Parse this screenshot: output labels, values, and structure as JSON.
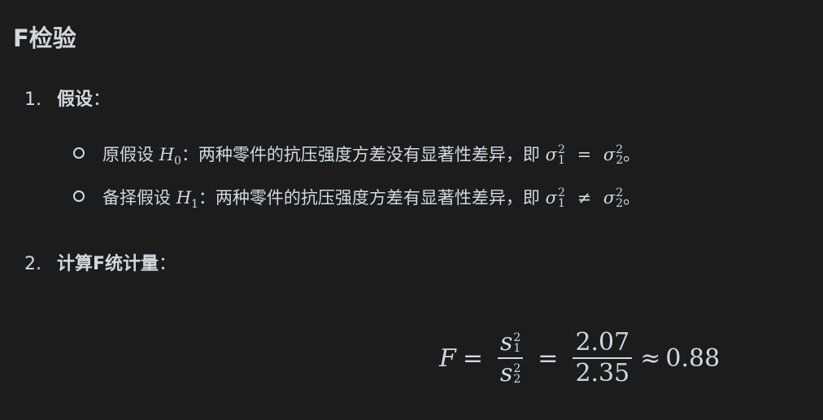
{
  "heading": "F检验",
  "items": [
    {
      "number": "1.",
      "title": "假设",
      "colon": "："
    },
    {
      "number": "2.",
      "title": "计算F统计量",
      "colon": "："
    }
  ],
  "hypotheses": [
    {
      "label": "原假设",
      "symbol": "H",
      "sub": "0",
      "text": "：两种零件的抗压强度方差没有显著性差异，即",
      "lhs": "σ",
      "lhs_sup": "2",
      "lhs_sub": "1",
      "relation": "=",
      "rhs": "σ",
      "rhs_sup": "2",
      "rhs_sub": "2",
      "end": "。"
    },
    {
      "label": "备择假设",
      "symbol": "H",
      "sub": "1",
      "text": "：两种零件的抗压强度方差有显著性差异，即",
      "lhs": "σ",
      "lhs_sup": "2",
      "lhs_sub": "1",
      "relation": "≠",
      "rhs": "σ",
      "rhs_sup": "2",
      "rhs_sub": "2",
      "end": "。"
    }
  ],
  "formula": {
    "lhs": "F",
    "eq1": "=",
    "num_var": "s",
    "num_sup": "2",
    "num_sub": "1",
    "den_var": "s",
    "den_sup": "2",
    "den_sub": "2",
    "eq2": "=",
    "num_value": "2.07",
    "den_value": "2.35",
    "approx": "≈",
    "result": "0.88"
  }
}
